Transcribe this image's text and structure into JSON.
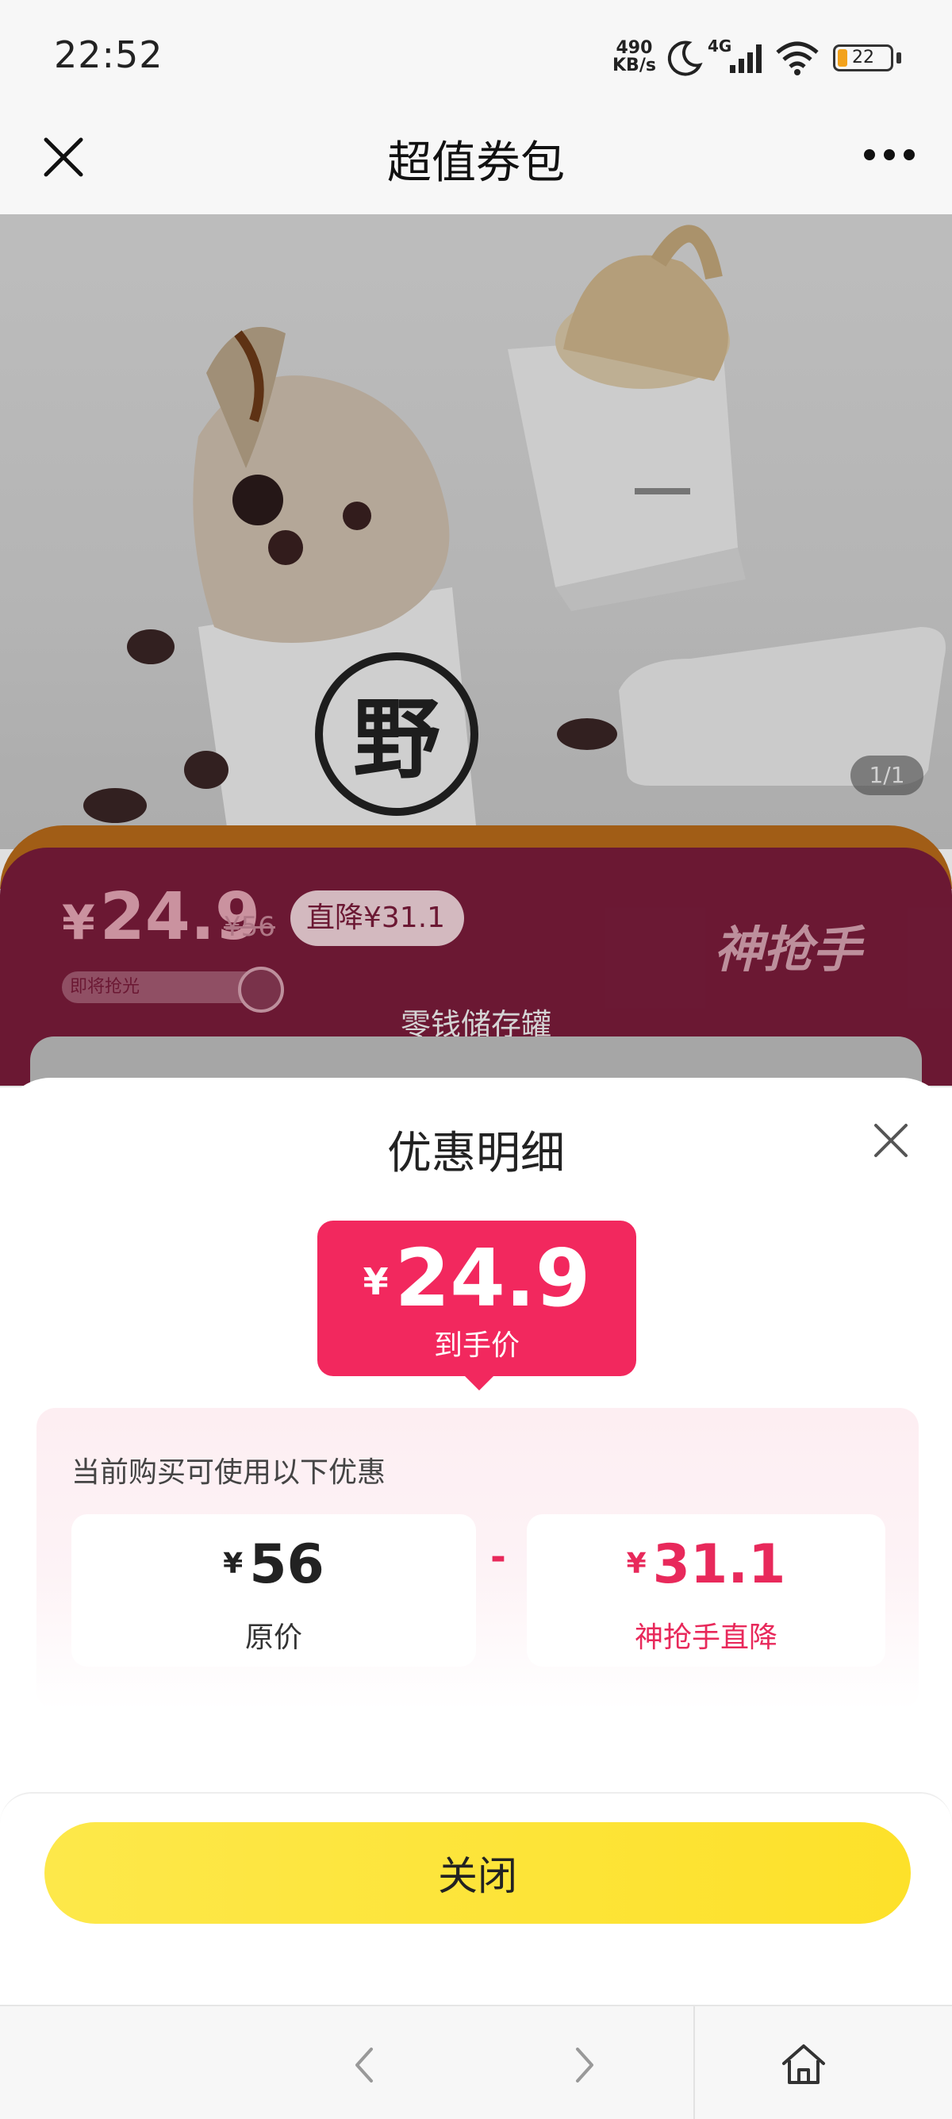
{
  "status_bar": {
    "time": "22:52",
    "net_speed_value": "490",
    "net_speed_unit": "KB/s",
    "network_label": "4G",
    "battery_level": "22",
    "icons": [
      "moon-icon",
      "signal-icon",
      "wifi-icon",
      "battery-icon"
    ]
  },
  "nav": {
    "title": "超值券包",
    "icons": [
      "close-icon",
      "more-icon"
    ]
  },
  "product": {
    "image_counter": "1/1",
    "price_currency": "¥",
    "price": "24.9",
    "original_price": "¥56",
    "direct_drop": "直降¥31.1",
    "stock_status": "即将抢光",
    "brand": "神抢手",
    "caption": "零钱储存罐"
  },
  "sheet": {
    "title": "优惠明细",
    "final": {
      "currency": "¥",
      "price": "24.9",
      "label": "到手价"
    },
    "detail_caption": "当前购买可使用以下优惠",
    "original": {
      "currency": "¥",
      "value": "56",
      "label": "原价"
    },
    "minus": "-",
    "discount": {
      "currency": "¥",
      "value": "31.1",
      "label": "神抢手直降"
    },
    "close_button": "关闭"
  },
  "browser_bar": {
    "icons": [
      "back-icon",
      "forward-icon",
      "home-icon"
    ]
  },
  "colors": {
    "accent_red": "#f2285e",
    "button_yellow": "#fde12a",
    "band": "#7a1c3b"
  }
}
